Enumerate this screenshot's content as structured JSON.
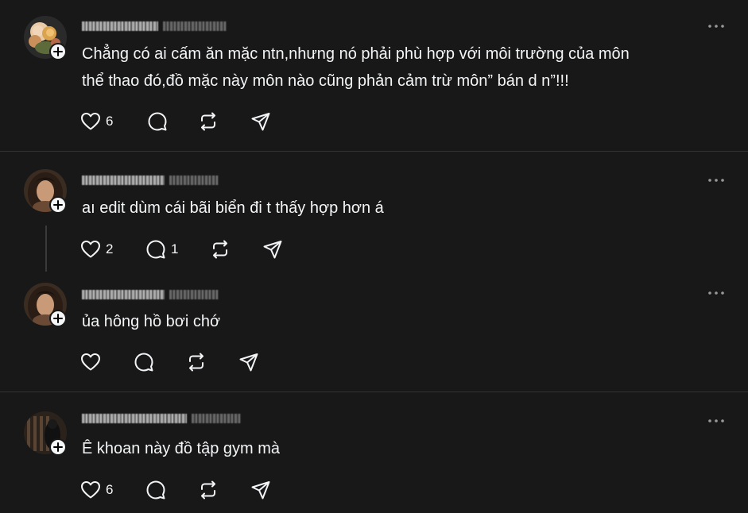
{
  "posts": [
    {
      "text": "Chẳng có ai cấm ăn mặc ntn,nhưng nó phải phù hợp với môi trường của môn thể thao đó,đồ mặc này môn nào cũng phản cảm trừ môn” bán d   n”!!!",
      "likes": "6",
      "replies": "",
      "avatar": "flower-avatar"
    },
    {
      "text": "aı edit dùm cái bãi biển đi t thấy hợp hơn á",
      "likes": "2",
      "replies": "1",
      "avatar": "girl-avatar"
    },
    {
      "text": "ủa hông hồ bơi chớ",
      "likes": "",
      "replies": "",
      "avatar": "girl-avatar"
    },
    {
      "text": "Ê khoan này đồ tập gym mà",
      "likes": "6",
      "replies": "",
      "avatar": "dark-avatar"
    }
  ],
  "icons": {
    "like": "heart-icon",
    "reply": "comment-icon",
    "repost": "repost-icon",
    "share": "send-icon",
    "more": "more-icon",
    "follow": "plus-icon"
  },
  "colors": {
    "background": "#181818",
    "text": "#f3f5f7",
    "divider": "#323232"
  }
}
